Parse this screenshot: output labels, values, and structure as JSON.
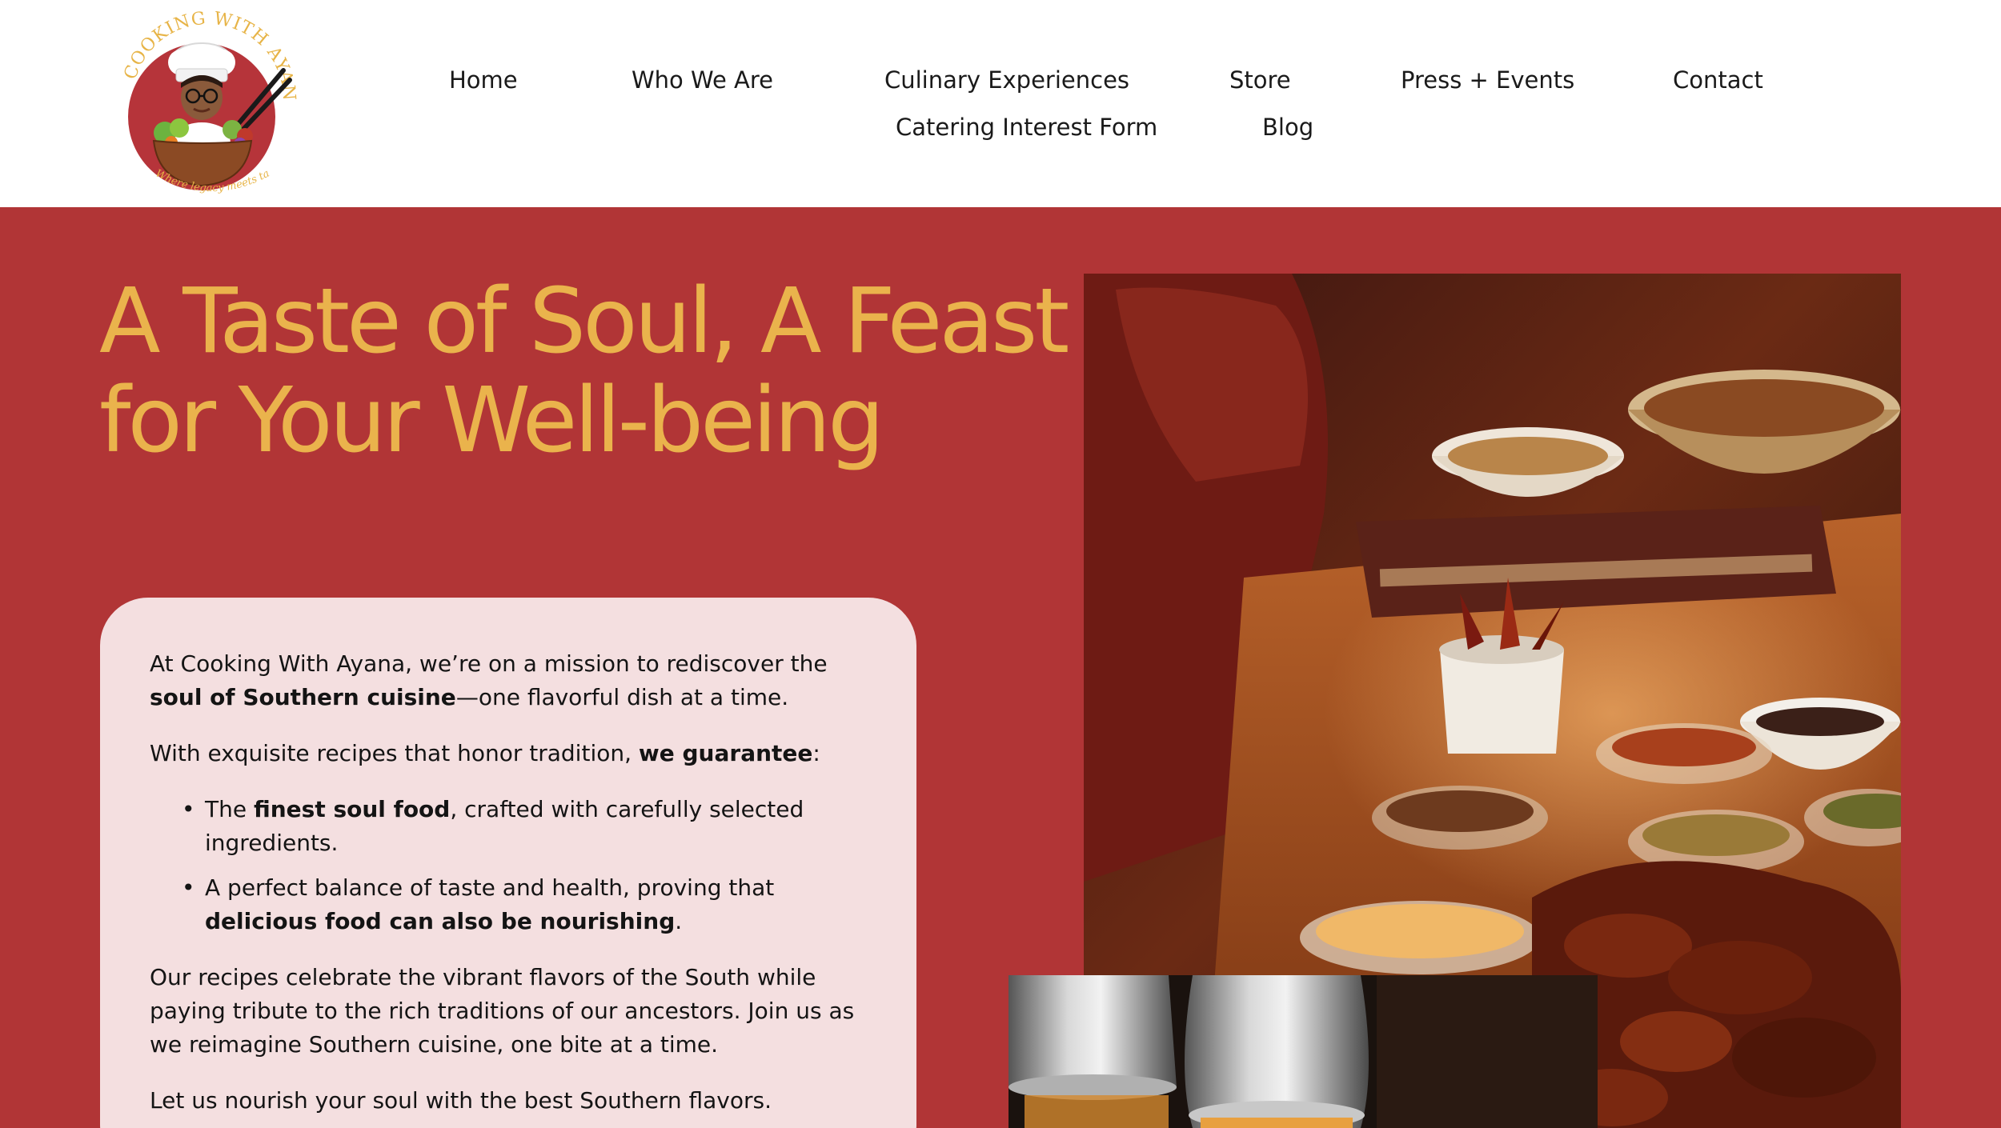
{
  "brand": {
    "arc_text": "COOKING WITH AYANA",
    "tagline": "Where legacy meets taste"
  },
  "nav": {
    "row1": [
      "Home",
      "Who We Are",
      "Culinary Experiences",
      "Store",
      "Press + Events",
      "Contact"
    ],
    "row2": [
      "Catering Interest Form",
      "Blog"
    ]
  },
  "hero": {
    "title_line1": "A Taste of Soul, A Feast",
    "title_line2": "for Your Well-being"
  },
  "card": {
    "p1_a": "At Cooking With Ayana, we’re on a mission to rediscover the ",
    "p1_b": "soul of Southern cuisine",
    "p1_c": "—one flavorful dish at a time.",
    "p2_a": "With exquisite recipes that honor tradition, ",
    "p2_b": "we guarantee",
    "p2_c": ":",
    "bullet_char": "•",
    "li1_a": "The ",
    "li1_b": "finest soul food",
    "li1_c": ", crafted with carefully selected ingredients.",
    "li2_a": "A perfect balance of taste and health, proving that ",
    "li2_b": "delicious food can also be nourishing",
    "li2_c": ".",
    "p3": "Our recipes celebrate the vibrant flavors of the South while paying tribute to the rich traditions of our ancestors. Join us as we reimagine Southern cuisine, one bite at a time.",
    "p4": "Let us nourish your soul with the best Southern flavors."
  },
  "colors": {
    "header_bg": "#ffffff",
    "hero_bg": "#b13536",
    "title_gold": "#eab34c",
    "card_bg": "#f4dfe0",
    "nav_text": "#1a1a1a"
  },
  "icons": {
    "logo": "chef-avatar-logo-icon"
  }
}
